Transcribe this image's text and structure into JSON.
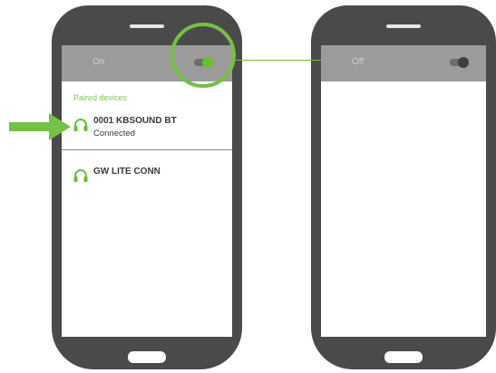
{
  "left_phone": {
    "bluetooth_state": "On",
    "toggle_on": true,
    "section_label": "Paired devices",
    "devices": [
      {
        "name": "0001 KBSOUND BT",
        "status": "Connected",
        "icon": "headphones-icon"
      },
      {
        "name": "GW LITE CONN",
        "status": "",
        "icon": "headphones-icon"
      }
    ]
  },
  "right_phone": {
    "bluetooth_state": "Off",
    "toggle_on": false
  },
  "colors": {
    "accent_green": "#74c143",
    "phone_body": "#4a4a4a",
    "topbar": "#9b9b9b"
  }
}
